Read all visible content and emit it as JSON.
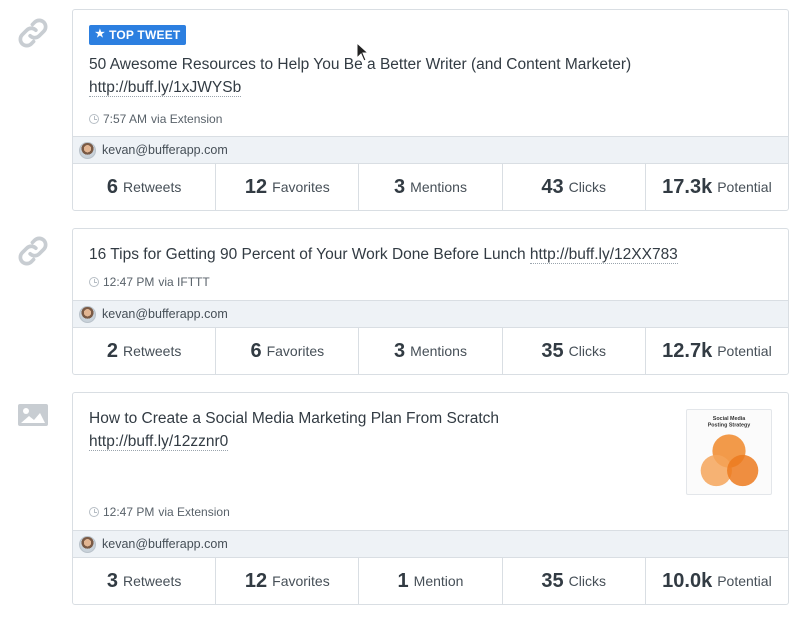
{
  "posts": [
    {
      "type_icon": "link-icon",
      "badge": "TOP TWEET",
      "text": "50 Awesome Resources to Help You Be a Better Writer (and Content Marketer)",
      "link": "http://buff.ly/1xJWYSb",
      "time": "7:57 AM",
      "via": "via Extension",
      "account": "kevan@bufferapp.com",
      "stats": [
        {
          "num": "6",
          "label": "Retweets"
        },
        {
          "num": "12",
          "label": "Favorites"
        },
        {
          "num": "3",
          "label": "Mentions"
        },
        {
          "num": "43",
          "label": "Clicks"
        },
        {
          "num": "17.3k",
          "label": "Potential"
        }
      ]
    },
    {
      "type_icon": "link-icon",
      "text": "16 Tips for Getting 90 Percent of Your Work Done Before Lunch",
      "link": "http://buff.ly/12XX783",
      "time": "12:47 PM",
      "via": "via IFTTT",
      "account": "kevan@bufferapp.com",
      "stats": [
        {
          "num": "2",
          "label": "Retweets"
        },
        {
          "num": "6",
          "label": "Favorites"
        },
        {
          "num": "3",
          "label": "Mentions"
        },
        {
          "num": "35",
          "label": "Clicks"
        },
        {
          "num": "12.7k",
          "label": "Potential"
        }
      ]
    },
    {
      "type_icon": "image-icon",
      "text": "How to Create a Social Media Marketing Plan From Scratch",
      "link": "http://buff.ly/12zznr0",
      "time": "12:47 PM",
      "via": "via Extension",
      "account": "kevan@bufferapp.com",
      "thumbnail": {
        "title_line1": "Social Media",
        "title_line2": "Posting Strategy"
      },
      "stats": [
        {
          "num": "3",
          "label": "Retweets"
        },
        {
          "num": "12",
          "label": "Favorites"
        },
        {
          "num": "1",
          "label": "Mention"
        },
        {
          "num": "35",
          "label": "Clicks"
        },
        {
          "num": "10.0k",
          "label": "Potential"
        }
      ]
    }
  ],
  "colors": {
    "badge": "#2c7fe0",
    "border": "#d9dee3",
    "account_bar": "#eef2f6",
    "text": "#323b43",
    "venn": "#f0882a"
  }
}
